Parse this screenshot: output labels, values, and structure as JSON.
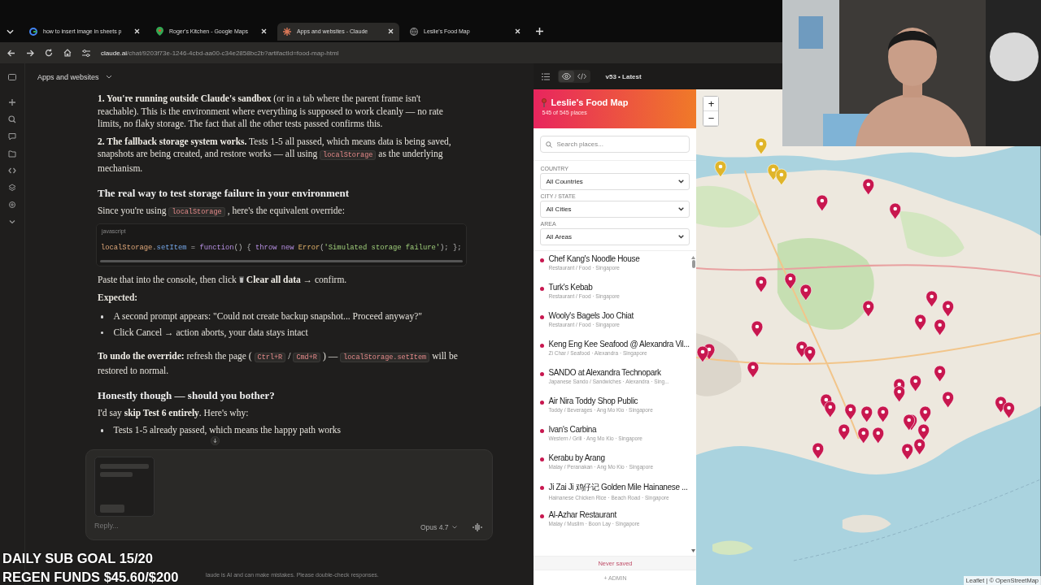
{
  "browser_tabs": [
    {
      "title": "how to insert image in sheets p",
      "kind": "google",
      "selected": false
    },
    {
      "title": "Roger's Kitchen - Google Maps",
      "kind": "maps",
      "selected": false
    },
    {
      "title": "Apps and websites - Claude",
      "kind": "claude",
      "selected": true
    },
    {
      "title": "Leslie's Food Map",
      "kind": "globe",
      "selected": false
    }
  ],
  "address": {
    "host": "claude.ai",
    "path": "/chat/9203f73e-1246-4cbd-aa00-c34e2858bc2b?artifactId=food-map-html"
  },
  "chat": {
    "title": "Apps and websites",
    "blocks": [
      {
        "kind": "paragraph",
        "parts": [
          {
            "kind": "text",
            "text": "**1. You're running outside Claude's sandbox** (or in a tab where the parent frame isn't reachable). This is the environment where everything is supposed to work cleanly — no rate limits, no flaky storage. The fact that all the other tests passed confirms this."
          }
        ]
      },
      {
        "kind": "paragraph",
        "parts": [
          {
            "kind": "text",
            "text": "**2. The fallback storage system works.** Tests 1-5 all passed, which means data is being saved, snapshots are being created, and restore works — all using"
          },
          {
            "kind": "code",
            "text": "localStorage"
          },
          {
            "kind": "text",
            "text": "as the underlying mechanism."
          }
        ]
      },
      {
        "kind": "heading",
        "text": "The real way to test storage failure in your environment"
      },
      {
        "kind": "paragraph",
        "parts": [
          {
            "kind": "text",
            "text": "Since you're using"
          },
          {
            "kind": "code",
            "text": "localStorage"
          },
          {
            "kind": "text",
            "text": ", here's the equivalent override:"
          }
        ]
      },
      {
        "kind": "code_block",
        "language": "javascript",
        "tokens": [
          {
            "kind": "variable",
            "text": "localStorage"
          },
          {
            "kind": "plain",
            "text": "."
          },
          {
            "kind": "property",
            "text": "setItem"
          },
          {
            "kind": "plain",
            "text": " = "
          },
          {
            "kind": "keyword",
            "text": "function"
          },
          {
            "kind": "plain",
            "text": "() { "
          },
          {
            "kind": "keyword",
            "text": "throw new "
          },
          {
            "kind": "class",
            "text": "Error"
          },
          {
            "kind": "plain",
            "text": "("
          },
          {
            "kind": "string",
            "text": "'Simulated storage failure'"
          },
          {
            "kind": "plain",
            "text": "); };"
          }
        ]
      },
      {
        "kind": "paragraph",
        "parts": [
          {
            "kind": "text",
            "text": "Paste that into the console, then click"
          },
          {
            "kind": "trash_icon"
          },
          {
            "kind": "text",
            "text": "**Clear all data** → confirm."
          }
        ]
      },
      {
        "kind": "subheading",
        "text": "Expected:"
      },
      {
        "kind": "bullets",
        "items": [
          "A second prompt appears: \"Could not create backup snapshot... Proceed anyway?\"",
          "Click Cancel → action aborts, your data stays intact"
        ]
      },
      {
        "kind": "paragraph",
        "parts": [
          {
            "kind": "text",
            "text": "**To undo the override:** refresh the page ("
          },
          {
            "kind": "code",
            "text": "Ctrl+R"
          },
          {
            "kind": "text",
            "text": "/"
          },
          {
            "kind": "code",
            "text": "Cmd+R"
          },
          {
            "kind": "text",
            "text": ") —"
          },
          {
            "kind": "code",
            "text": "localStorage.setItem"
          },
          {
            "kind": "text",
            "text": "will be restored to normal."
          }
        ]
      },
      {
        "kind": "heading",
        "text": "Honestly though — should you bother?"
      },
      {
        "kind": "paragraph",
        "parts": [
          {
            "kind": "text",
            "text": "I'd say **skip Test 6 entirely**. Here's why:"
          }
        ]
      },
      {
        "kind": "bullets",
        "items": [
          "Tests 1-5 already passed, which means the happy path works"
        ]
      }
    ],
    "composer": {
      "placeholder": "Reply...",
      "model": "Opus 4.7"
    },
    "disclaimer": "laude is AI and can make mistakes. Please double-check responses."
  },
  "artifact": {
    "view_toggle": [
      {
        "kind": "preview",
        "selected": true
      },
      {
        "kind": "code",
        "selected": false
      }
    ],
    "version": "v53 • Latest"
  },
  "food_map": {
    "title": "Leslie's Food Map",
    "count": "545 of 545 places",
    "search": {
      "placeholder": "Search places..."
    },
    "filters": [
      {
        "label": "COUNTRY",
        "value": "All Countries"
      },
      {
        "label": "CITY / STATE",
        "value": "All Cities"
      },
      {
        "label": "AREA",
        "value": "All Areas"
      }
    ],
    "places": [
      {
        "name": "Chef Kang's Noodle House",
        "meta": "Restaurant / Food · Singapore"
      },
      {
        "name": "Turk's Kebab",
        "meta": "Restaurant / Food · Singapore"
      },
      {
        "name": "Wooly's Bagels Joo Chiat",
        "meta": "Restaurant / Food · Singapore"
      },
      {
        "name": "Keng Eng Kee Seafood @ Alexandra Vil...",
        "meta": "Zi Char / Seafood · Alexandra · Singapore"
      },
      {
        "name": "SANDO at Alexandra Technopark",
        "meta": "Japanese Sando / Sandwiches · Alexandra · Sing..."
      },
      {
        "name": "Air Nira Toddy Shop Public",
        "meta": "Toddy / Beverages · Ang Mo Kio · Singapore"
      },
      {
        "name": "Ivan's Carbina",
        "meta": "Western / Grill · Ang Mo Kio · Singapore"
      },
      {
        "name": "Kerabu by Arang",
        "meta": "Malay / Peranakan · Ang Mo Kio · Singapore"
      },
      {
        "name": "Ji Zai Ji 鸡仔记 Golden Mile Hainanese ...",
        "meta": "Hainanese Chicken Rice · Beach Road · Singapore"
      },
      {
        "name": "Al-Azhar Restaurant",
        "meta": "Malay / Muslim · Boon Lay · Singapore"
      }
    ],
    "save_status": "Never saved",
    "admin": "+ ADMIN",
    "zoom": [
      "+",
      "−"
    ],
    "attribution": "Leaflet | © OpenStreetMap"
  },
  "stream_overlay": [
    "DAILY SUB GOAL 15/20",
    "REGEN FUNDS $45.60/$200"
  ]
}
